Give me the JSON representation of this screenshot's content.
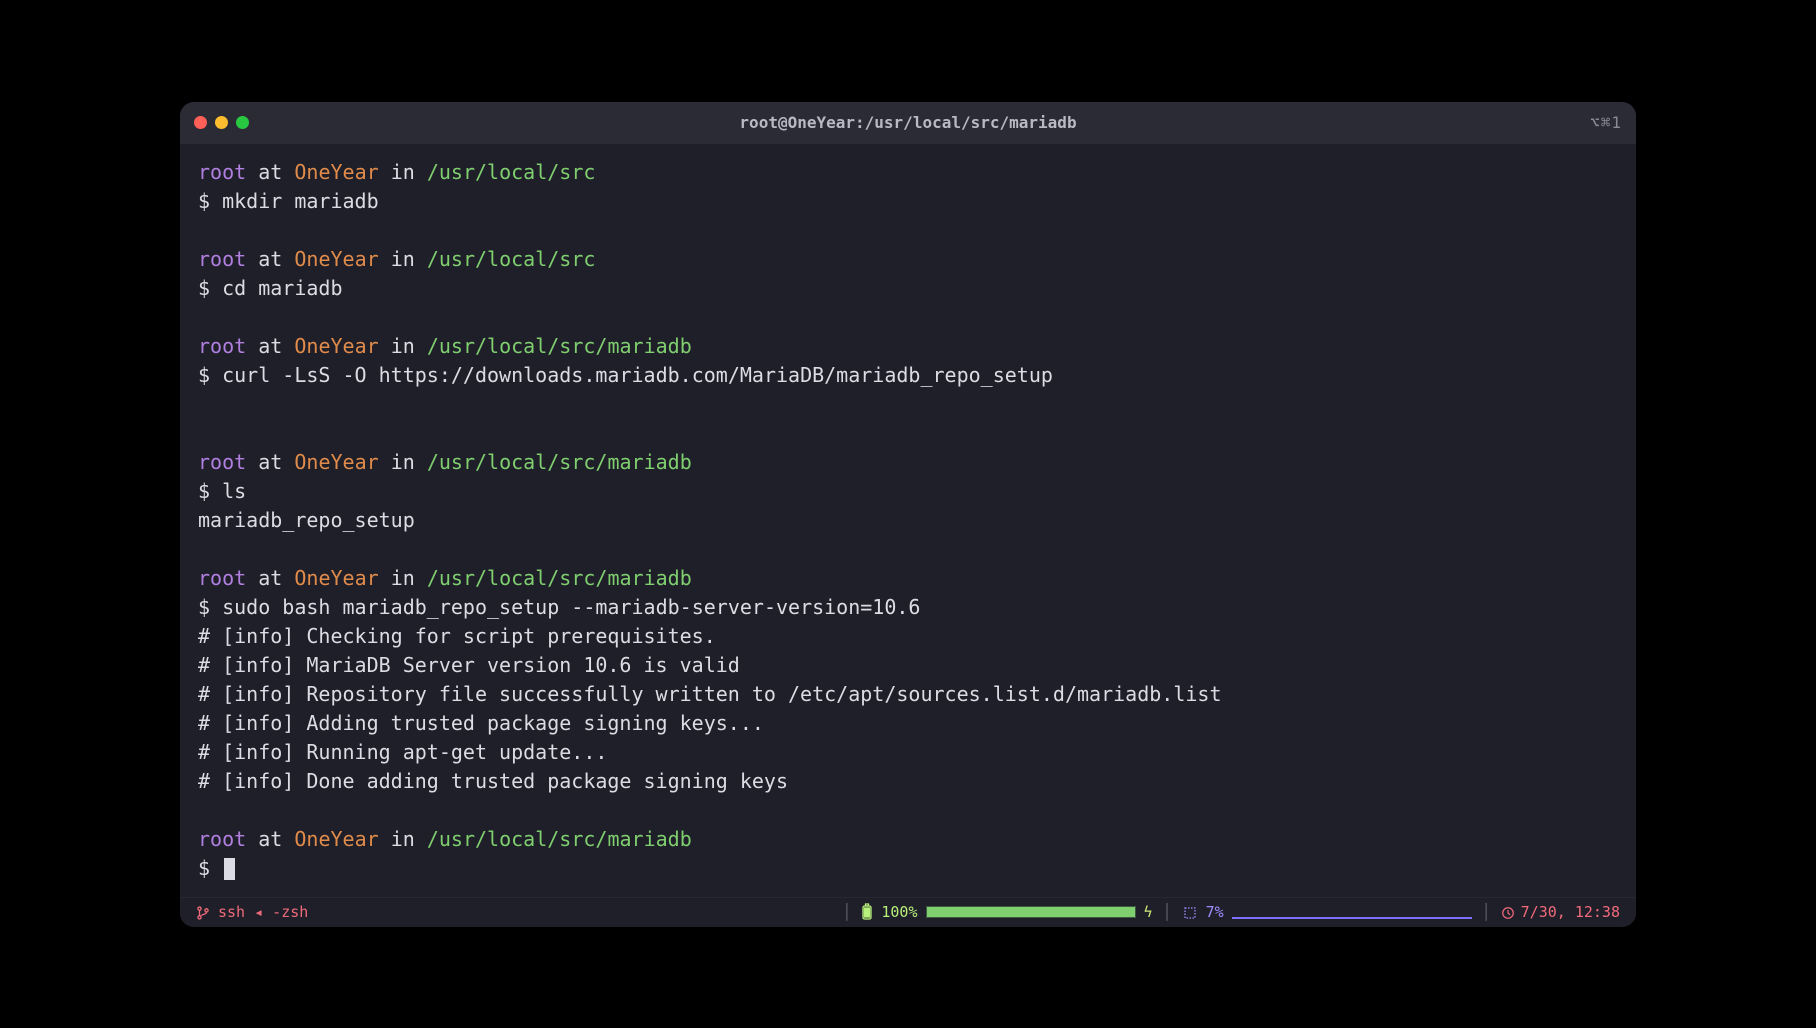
{
  "window": {
    "title": "root@OneYear:/usr/local/src/mariadb",
    "shortcut_hint": "⌥⌘1"
  },
  "prompt": {
    "user": "root",
    "at": "at",
    "host": "OneYear",
    "in": "in"
  },
  "blocks": [
    {
      "path": "/usr/local/src",
      "cmd": "mkdir mariadb",
      "output": []
    },
    {
      "path": "/usr/local/src",
      "cmd": "cd mariadb",
      "output": []
    },
    {
      "path": "/usr/local/src/mariadb",
      "cmd": "curl -LsS -O https://downloads.mariadb.com/MariaDB/mariadb_repo_setup",
      "output": [
        ""
      ]
    },
    {
      "path": "/usr/local/src/mariadb",
      "cmd": "ls",
      "output": [
        "mariadb_repo_setup"
      ]
    },
    {
      "path": "/usr/local/src/mariadb",
      "cmd": "sudo bash mariadb_repo_setup --mariadb-server-version=10.6",
      "output": [
        "# [info] Checking for script prerequisites.",
        "# [info] MariaDB Server version 10.6 is valid",
        "# [info] Repository file successfully written to /etc/apt/sources.list.d/mariadb.list",
        "# [info] Adding trusted package signing keys...",
        "# [info] Running apt-get update...",
        "# [info] Done adding trusted package signing keys"
      ]
    },
    {
      "path": "/usr/local/src/mariadb",
      "cmd": "",
      "cursor": true,
      "output": []
    }
  ],
  "status": {
    "left": "ssh ◂ -zsh",
    "battery_pct": "100%",
    "cpu_pct": "7%",
    "clock": "7/30, 12:38"
  }
}
